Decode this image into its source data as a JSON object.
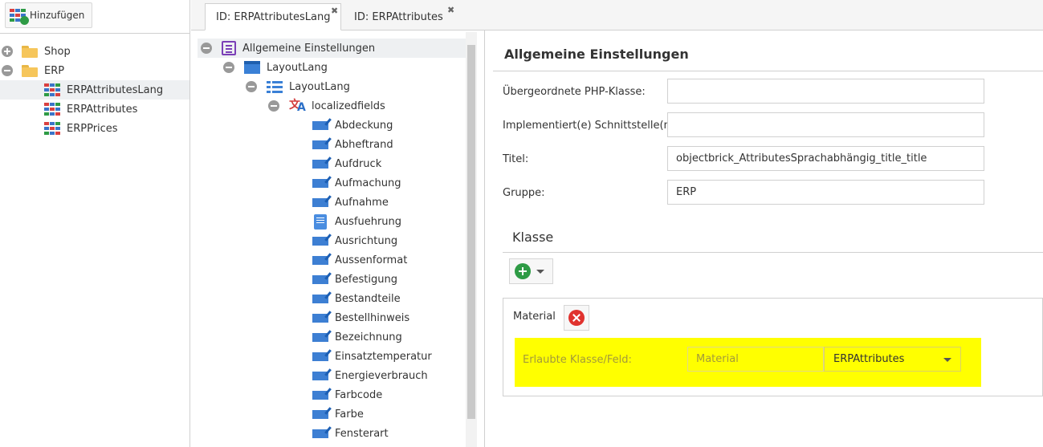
{
  "left_panel": {
    "add_button": "Hinzufügen",
    "tree": [
      {
        "label": "Shop",
        "type": "folder",
        "state": "collapsed"
      },
      {
        "label": "ERP",
        "type": "folder",
        "state": "expanded"
      },
      {
        "label": "ERPAttributesLang",
        "type": "objectbrick",
        "selected": true
      },
      {
        "label": "ERPAttributes",
        "type": "objectbrick"
      },
      {
        "label": "ERPPrices",
        "type": "objectbrick"
      }
    ]
  },
  "tabs": [
    {
      "label": "ID: ERPAttributesLang",
      "active": true
    },
    {
      "label": "ID: ERPAttributes",
      "active": false
    }
  ],
  "layout_tree": {
    "root": "Allgemeine Einstellungen",
    "layout1": "LayoutLang",
    "layout2": "LayoutLang",
    "localized": "localizedfields",
    "fields": [
      {
        "label": "Abdeckung",
        "icon": "input-icon"
      },
      {
        "label": "Abheftrand",
        "icon": "input-icon"
      },
      {
        "label": "Aufdruck",
        "icon": "input-icon"
      },
      {
        "label": "Aufmachung",
        "icon": "input-icon"
      },
      {
        "label": "Aufnahme",
        "icon": "input-icon"
      },
      {
        "label": "Ausfuehrung",
        "icon": "textarea-icon"
      },
      {
        "label": "Ausrichtung",
        "icon": "input-icon"
      },
      {
        "label": "Aussenformat",
        "icon": "input-icon"
      },
      {
        "label": "Befestigung",
        "icon": "input-icon"
      },
      {
        "label": "Bestandteile",
        "icon": "input-icon"
      },
      {
        "label": "Bestellhinweis",
        "icon": "input-icon"
      },
      {
        "label": "Bezeichnung",
        "icon": "input-icon"
      },
      {
        "label": "Einsatztemperatur",
        "icon": "input-icon"
      },
      {
        "label": "Energieverbrauch",
        "icon": "input-icon"
      },
      {
        "label": "Farbcode",
        "icon": "input-icon"
      },
      {
        "label": "Farbe",
        "icon": "input-icon"
      },
      {
        "label": "Fensterart",
        "icon": "input-icon"
      }
    ]
  },
  "form": {
    "title": "Allgemeine Einstellungen",
    "parent_class_label": "Übergeordnete PHP-Klasse:",
    "parent_class_value": "",
    "interfaces_label": "Implementiert(e) Schnittstelle(n):",
    "interfaces_value": "",
    "titel_label": "Titel:",
    "titel_value": "objectbrick_AttributesSprachabhängig_title_title",
    "gruppe_label": "Gruppe:",
    "gruppe_value": "ERP",
    "klasse_heading": "Klasse",
    "material_panel": {
      "title": "Material",
      "allowed_label": "Erlaubte Klasse/Feld:",
      "class_value": "Material",
      "field_value": "ERPAttributes"
    }
  },
  "colors": {
    "highlight": "#ffff00",
    "add_green": "#2e9b45",
    "delete_red": "#e0322e",
    "input_icon_blue": "#3d7fd3"
  }
}
